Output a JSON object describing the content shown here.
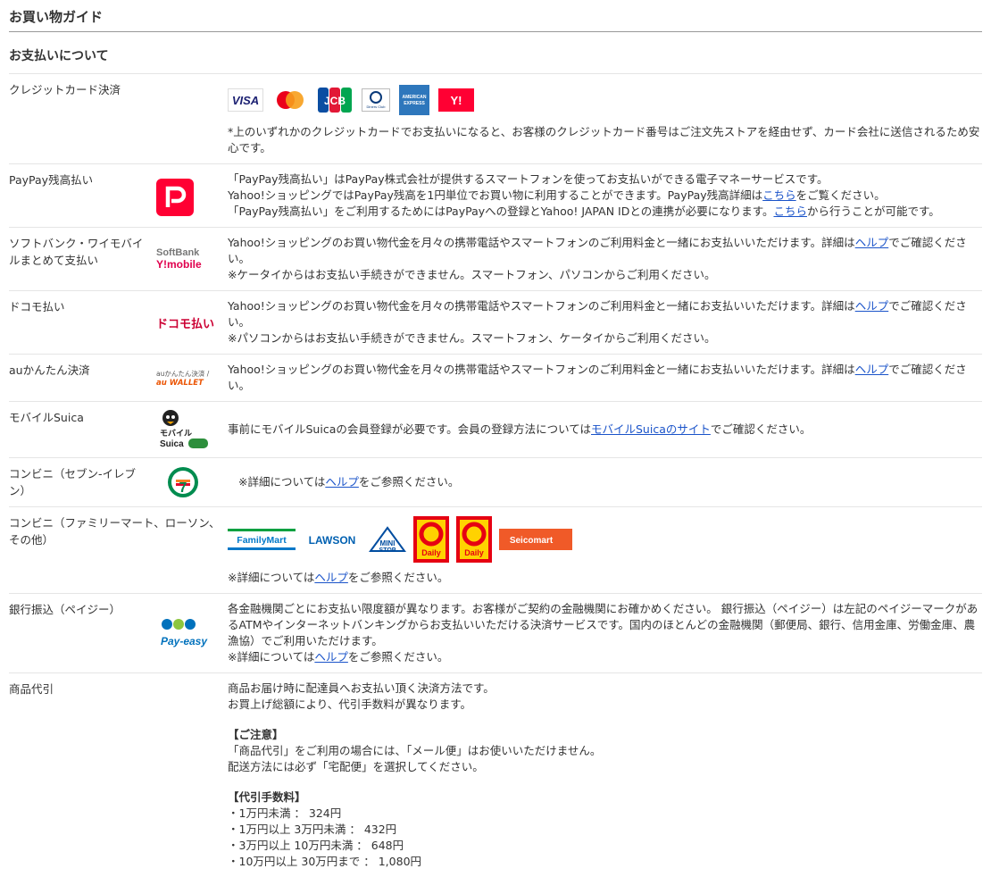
{
  "page_title": "お買い物ガイド",
  "section_title": "お支払いについて",
  "credit": {
    "name": "クレジットカード決済",
    "cards": [
      "VISA",
      "JCB",
      "Diners Club",
      "AMERICAN EXPRESS",
      "Y!"
    ],
    "note": "*上のいずれかのクレジットカードでお支払いになると、お客様のクレジットカード番号はご注文先ストアを経由せず、カード会社に送信されるため安心です。"
  },
  "paypay": {
    "name": "PayPay残高払い",
    "line1": "「PayPay残高払い」はPayPay株式会社が提供するスマートフォンを使ってお支払いができる電子マネーサービスです。",
    "line2_pre": "Yahoo!ショッピングではPayPay残高を1円単位でお買い物に利用することができます。PayPay残高詳細は",
    "line2_link": "こちら",
    "line2_post": "をご覧ください。",
    "line3_pre": "「PayPay残高払い」をご利用するためにはPayPayへの登録とYahoo! JAPAN IDとの連携が必要になります。",
    "line3_link": "こちら",
    "line3_post": "から行うことが可能です。"
  },
  "softbank": {
    "name": "ソフトバンク・ワイモバイルまとめて支払い",
    "logo_top": "SoftBank",
    "logo_bottom": "Y!mobile",
    "desc_pre": "Yahoo!ショッピングのお買い物代金を月々の携帯電話やスマートフォンのご利用料金と一緒にお支払いいただけます。詳細は",
    "link": "ヘルプ",
    "desc_post": "でご確認ください。",
    "note": "※ケータイからはお支払い手続きができません。スマートフォン、パソコンからご利用ください。"
  },
  "docomo": {
    "name": "ドコモ払い",
    "logo": "ドコモ払い",
    "desc_pre": "Yahoo!ショッピングのお買い物代金を月々の携帯電話やスマートフォンのご利用料金と一緒にお支払いいただけます。詳細は",
    "link": "ヘルプ",
    "desc_post": "でご確認ください。",
    "note": "※パソコンからはお支払い手続きができません。スマートフォン、ケータイからご利用ください。"
  },
  "au": {
    "name": "auかんたん決済",
    "logo_top": "auかんたん決済 /",
    "logo_bottom": "au WALLET",
    "desc_pre": "Yahoo!ショッピングのお買い物代金を月々の携帯電話やスマートフォンのご利用料金と一緒にお支払いいただけます。詳細は",
    "link": "ヘルプ",
    "desc_post": "でご確認ください。"
  },
  "suica": {
    "name": "モバイルSuica",
    "logo_top": "モバイル",
    "logo_bottom": "Suica",
    "desc_pre": "事前にモバイルSuicaの会員登録が必要です。会員の登録方法については",
    "link": "モバイルSuicaのサイト",
    "desc_post": "でご確認ください。"
  },
  "seven": {
    "name": "コンビニ（セブン-イレブン）",
    "logo": "7",
    "desc_pre": "※詳細については",
    "link": "ヘルプ",
    "desc_post": "をご参照ください。"
  },
  "other_conv": {
    "name": "コンビニ（ファミリーマート、ローソン、その他）",
    "brands": [
      "FamilyMart",
      "LAWSON",
      "MINI STOP",
      "Daily",
      "Daily",
      "Seicomart"
    ],
    "desc_pre": "※詳細については",
    "link": "ヘルプ",
    "desc_post": "をご参照ください。"
  },
  "payeasy": {
    "name": "銀行振込（ペイジー）",
    "logo": "Pay-easy",
    "desc": "各金融機関ごとにお支払い限度額が異なります。お客様がご契約の金融機関にお確かめください。 銀行振込（ペイジー）は左記のペイジーマークがあるATMやインターネットバンキングからお支払いいただける決済サービスです。国内のほとんどの金融機関（郵便局、銀行、信用金庫、労働金庫、農漁協）でご利用いただけます。",
    "note_pre": "※詳細については",
    "link": "ヘルプ",
    "note_post": "をご参照ください。"
  },
  "cod": {
    "name": "商品代引",
    "line1": "商品お届け時に配達員へお支払い頂く決済方法です。",
    "line2": "お買上げ総額により、代引手数料が異なります。",
    "caution_head": "【ご注意】",
    "caution1": "「商品代引」をご利用の場合には、「メール便」はお使いいただけません。",
    "caution2": "配送方法には必ず「宅配便」を選択してください。",
    "fee_head": "【代引手数料】",
    "fees": [
      "・1万円未満 ： 324円",
      "・1万円以上 3万円未満 ： 432円",
      "・3万円以上 10万円未満 ： 648円",
      "・10万円以上 30万円まで ： 1,080円"
    ]
  }
}
